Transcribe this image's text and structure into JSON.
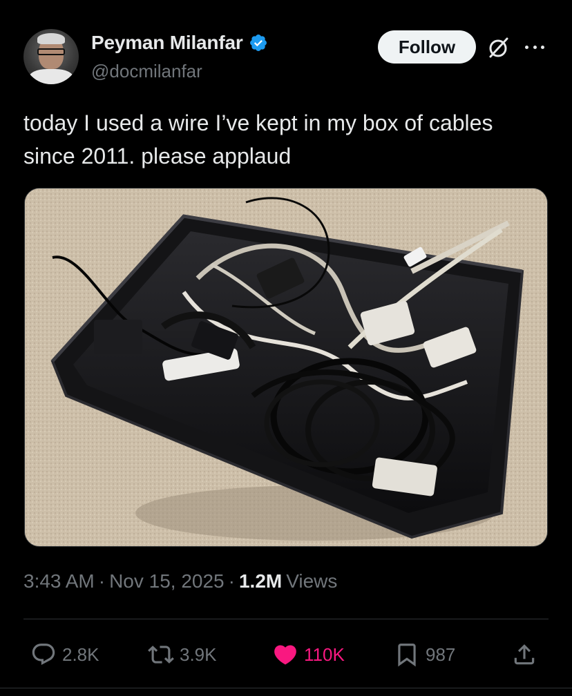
{
  "author": {
    "display_name": "Peyman Milanfar",
    "handle": "@docmilanfar",
    "verified": true
  },
  "header": {
    "follow_label": "Follow"
  },
  "tweet": {
    "text": "today I used a wire I’ve kept in my box of cables since 2011. please applaud",
    "time": "3:43 AM",
    "separator": "·",
    "date": "Nov 15, 2025",
    "views_count": "1.2M",
    "views_label": "Views"
  },
  "actions": {
    "replies": "2.8K",
    "reposts": "3.9K",
    "likes": "110K",
    "bookmarks": "987"
  },
  "colors": {
    "background": "#000000",
    "text_primary": "#e7e9ea",
    "text_secondary": "#71767b",
    "like_pink": "#f91880",
    "verified_blue": "#1d9bf0",
    "follow_bg": "#eff3f4"
  },
  "icons": {
    "reply": "reply-icon",
    "repost": "repost-icon",
    "like": "heart-icon",
    "bookmark": "bookmark-icon",
    "share": "share-icon",
    "grok": "grok-icon",
    "more": "more-icon"
  }
}
